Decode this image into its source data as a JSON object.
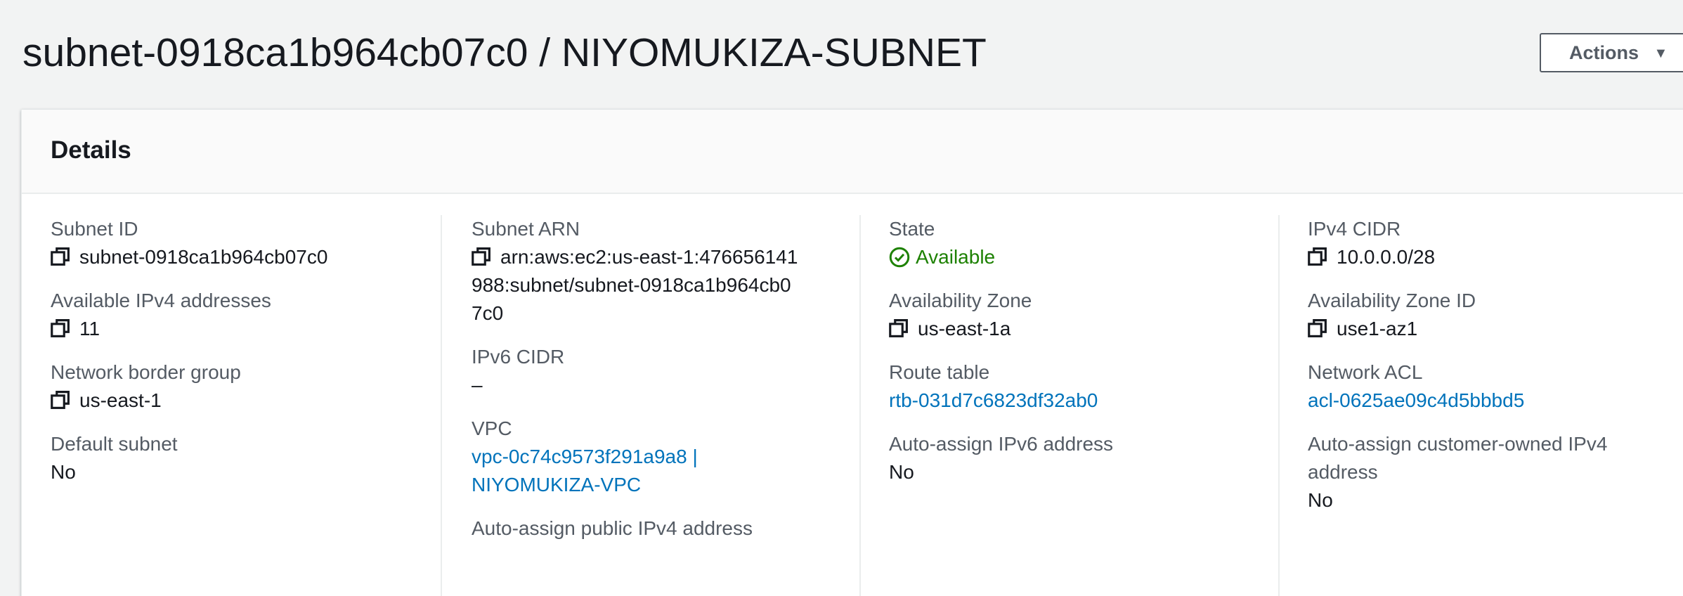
{
  "header": {
    "title": "subnet-0918ca1b964cb07c0 / NIYOMUKIZA-SUBNET",
    "actions_label": "Actions"
  },
  "details": {
    "title": "Details",
    "col1": {
      "subnet_id_label": "Subnet ID",
      "subnet_id_value": "subnet-0918ca1b964cb07c0",
      "available_ipv4_label": "Available IPv4 addresses",
      "available_ipv4_value": "11",
      "network_border_group_label": "Network border group",
      "network_border_group_value": "us-east-1",
      "default_subnet_label": "Default subnet",
      "default_subnet_value": "No"
    },
    "col2": {
      "subnet_arn_label": "Subnet ARN",
      "subnet_arn_value": "arn:aws:ec2:us-east-1:476656141988:subnet/subnet-0918ca1b964cb07c0",
      "ipv6_cidr_label": "IPv6 CIDR",
      "ipv6_cidr_value": "–",
      "vpc_label": "VPC",
      "vpc_value": "vpc-0c74c9573f291a9a8 | NIYOMUKIZA-VPC",
      "cutoff_label": "Auto-assign public IPv4 address"
    },
    "col3": {
      "state_label": "State",
      "state_value": "Available",
      "availability_zone_label": "Availability Zone",
      "availability_zone_value": "us-east-1a",
      "route_table_label": "Route table",
      "route_table_value": "rtb-031d7c6823df32ab0",
      "auto_assign_ipv6_label": "Auto-assign IPv6 address",
      "auto_assign_ipv6_value": "No"
    },
    "col4": {
      "ipv4_cidr_label": "IPv4 CIDR",
      "ipv4_cidr_value": "10.0.0.0/28",
      "availability_zone_id_label": "Availability Zone ID",
      "availability_zone_id_value": "use1-az1",
      "network_acl_label": "Network ACL",
      "network_acl_value": "acl-0625ae09c4d5bbbd5",
      "auto_assign_coip_label": "Auto-assign customer-owned IPv4 address",
      "auto_assign_coip_value": "No"
    }
  },
  "colors": {
    "link": "#0073bb",
    "success": "#1d8102",
    "label": "#545b64",
    "text": "#16191f",
    "background": "#f2f3f3"
  },
  "icons": {
    "copy": "copy-icon",
    "status": "status-positive-icon",
    "caret": "caret-down-icon"
  }
}
